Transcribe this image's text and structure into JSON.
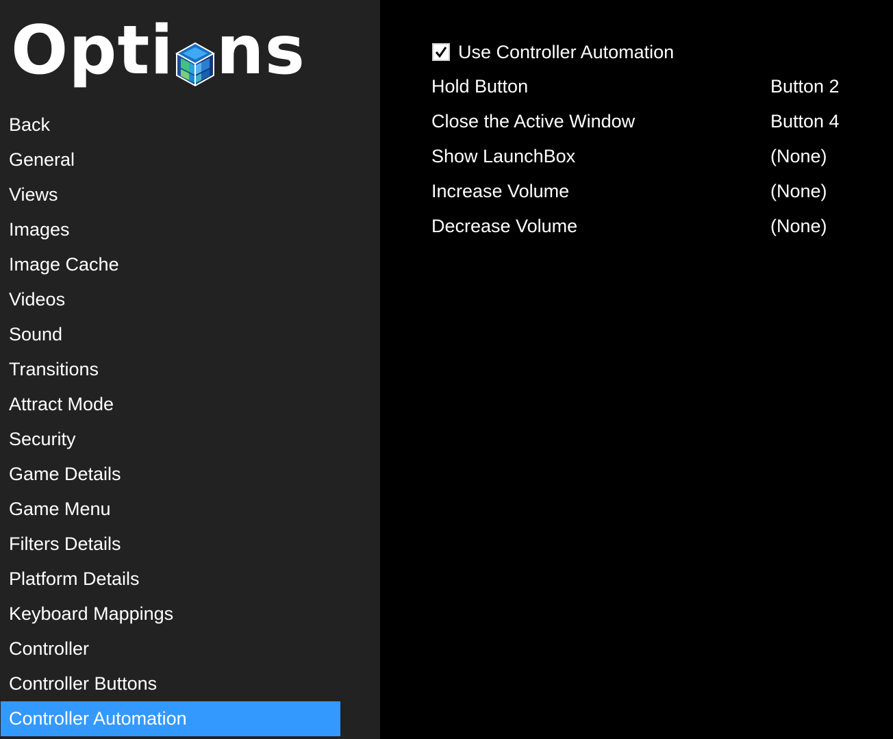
{
  "header": {
    "title_part1": "Opti",
    "title_part2": "ns",
    "logo_icon": "launchbox-cube-icon"
  },
  "sidebar": {
    "items": [
      {
        "label": "Back"
      },
      {
        "label": "General"
      },
      {
        "label": "Views"
      },
      {
        "label": "Images"
      },
      {
        "label": "Image Cache"
      },
      {
        "label": "Videos"
      },
      {
        "label": "Sound"
      },
      {
        "label": "Transitions"
      },
      {
        "label": "Attract Mode"
      },
      {
        "label": "Security"
      },
      {
        "label": "Game Details"
      },
      {
        "label": "Game Menu"
      },
      {
        "label": "Filters Details"
      },
      {
        "label": "Platform Details"
      },
      {
        "label": "Keyboard Mappings"
      },
      {
        "label": "Controller"
      },
      {
        "label": "Controller Buttons"
      },
      {
        "label": "Controller Automation",
        "active": true
      }
    ]
  },
  "main": {
    "automation_toggle": {
      "label": "Use Controller Automation",
      "checked": true
    },
    "mappings": [
      {
        "label": "Hold Button",
        "value": "Button 2"
      },
      {
        "label": "Close the Active Window",
        "value": "Button 4"
      },
      {
        "label": "Show LaunchBox",
        "value": "(None)"
      },
      {
        "label": "Increase Volume",
        "value": "(None)"
      },
      {
        "label": "Decrease Volume",
        "value": "(None)"
      }
    ]
  },
  "colors": {
    "sidebar_bg": "#222222",
    "content_bg": "#000000",
    "active_item": "#3399ff",
    "text": "#ffffff"
  }
}
